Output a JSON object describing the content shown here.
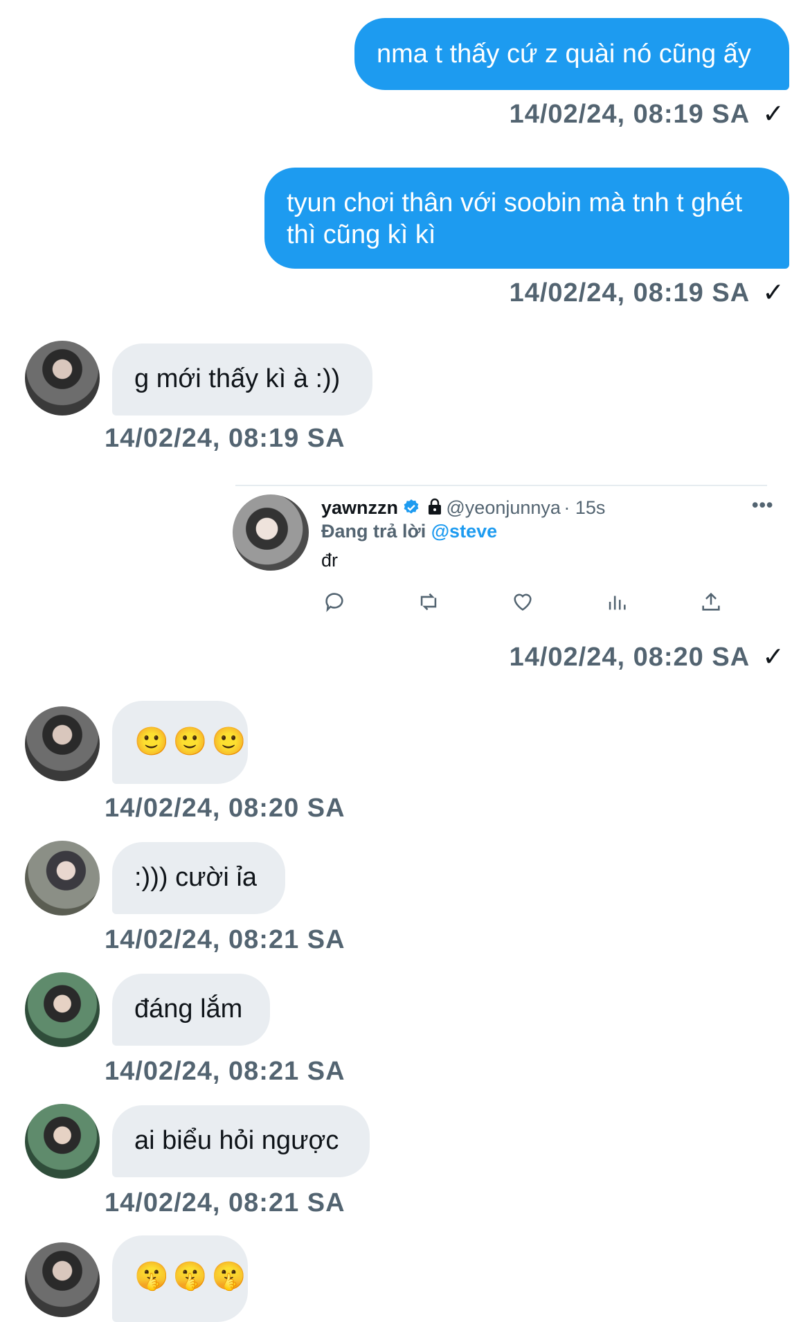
{
  "messages": [
    {
      "text": "nma t thấy cứ z quài nó cũng ấy",
      "timestamp": "14/02/24, 08:19 SA",
      "status": "✓"
    },
    {
      "text": "tyun chơi thân với soobin mà tnh t ghét thì cũng kì kì",
      "timestamp": "14/02/24, 08:19 SA",
      "status": "✓"
    },
    {
      "text": "g mới thấy kì à :))",
      "timestamp": "14/02/24, 08:19 SA"
    },
    {
      "timestamp": "14/02/24, 08:20 SA",
      "status": "✓"
    },
    {
      "text": "🙂🙂🙂",
      "timestamp": "14/02/24, 08:20 SA"
    },
    {
      "text": ":))) cười ỉa",
      "timestamp": "14/02/24, 08:21 SA"
    },
    {
      "text": "đáng lắm",
      "timestamp": "14/02/24, 08:21 SA"
    },
    {
      "text": "ai biểu hỏi ngược",
      "timestamp": "14/02/24, 08:21 SA"
    },
    {
      "text": "🤫🤫🤫"
    }
  ],
  "shared_tweet": {
    "display_name": "yawnzzn",
    "handle": "@yeonjunnya",
    "time": "· 15s",
    "more": "•••",
    "replying_prefix": "Đang trả lời",
    "replying_to": "@steve",
    "body": "đr",
    "verified_color": "#1d9bf0"
  },
  "colors": {
    "outgoing_bubble": "#1d9bf0",
    "incoming_bubble": "#e9edf1",
    "timestamp": "#536471"
  }
}
